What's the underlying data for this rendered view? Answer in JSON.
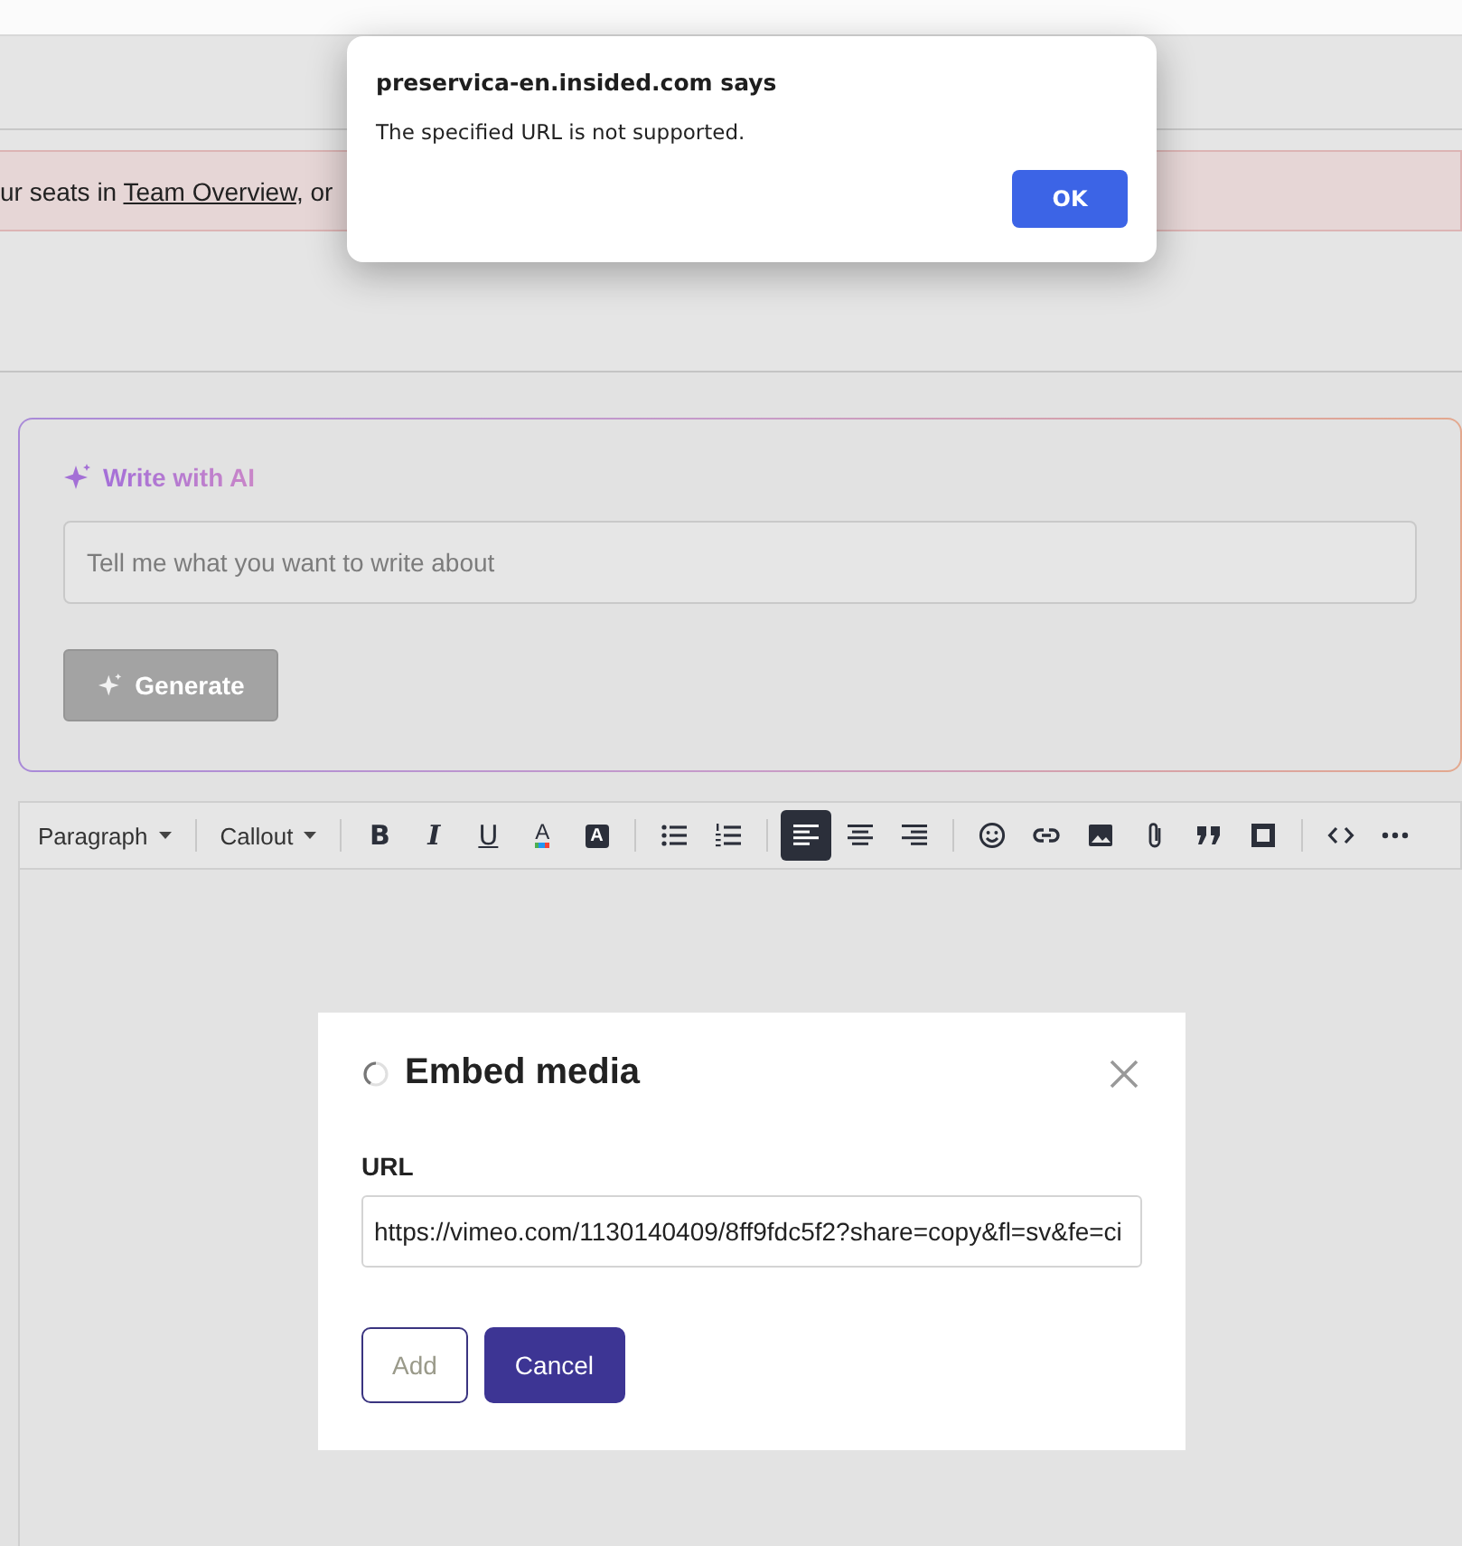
{
  "alert": {
    "title": "preservica-en.insided.com says",
    "message": "The specified URL is not supported.",
    "button": "OK"
  },
  "notice": {
    "text_before": "ur seats in ",
    "link": "Team Overview",
    "text_after": ", or"
  },
  "ai_panel": {
    "title": "Write with AI",
    "placeholder": "Tell me what you want to write about",
    "button": "Generate",
    "button_disabled": true
  },
  "toolbar": {
    "dropdowns": [
      "Paragraph",
      "Callout"
    ],
    "tools": [
      {
        "kind": "glyph",
        "label": "B",
        "selected": false
      },
      {
        "kind": "glyph",
        "label": "I",
        "selected": false
      },
      {
        "kind": "glyph",
        "label": "U",
        "selected": false
      },
      {
        "kind": "glyph",
        "label": "A",
        "selected": false
      },
      {
        "kind": "glyph",
        "label": "A",
        "selected": false
      },
      {
        "kind": "icon",
        "selected": false
      },
      {
        "kind": "icon",
        "selected": false
      },
      {
        "kind": "icon",
        "selected": true
      },
      {
        "kind": "icon",
        "selected": false
      },
      {
        "kind": "icon",
        "selected": false
      },
      {
        "kind": "icon",
        "selected": false
      },
      {
        "kind": "icon",
        "selected": false
      },
      {
        "kind": "icon",
        "selected": false
      },
      {
        "kind": "icon",
        "selected": false
      },
      {
        "kind": "icon",
        "selected": false
      },
      {
        "kind": "icon",
        "selected": false
      },
      {
        "kind": "icon",
        "selected": false
      },
      {
        "kind": "icon",
        "selected": false
      }
    ]
  },
  "embed_dialog": {
    "title": "Embed media",
    "loading": true,
    "field_label": "URL",
    "url": "https://vimeo.com/1130140409/8ff9fdc5f2?share=copy&fl=sv&fe=ci",
    "buttons": [
      {
        "label": "Add",
        "disabled": true
      },
      {
        "label": "Cancel",
        "disabled": false
      }
    ]
  }
}
